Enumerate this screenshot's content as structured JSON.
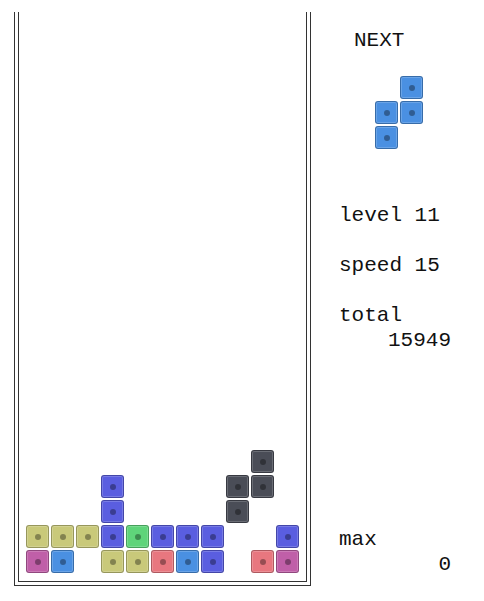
{
  "next": {
    "title": "NEXT",
    "piece": [
      [
        null,
        "#4a90e2"
      ],
      [
        "#4a90e2",
        "#4a90e2"
      ],
      [
        "#4a90e2",
        null
      ]
    ]
  },
  "stats": [
    {
      "label": "level",
      "value": "11",
      "kind": "inline"
    },
    {
      "label": "speed",
      "value": "15",
      "kind": "inline"
    },
    {
      "label": "total",
      "value": "15949",
      "kind": "stacked"
    },
    {
      "label": "max",
      "value": "0",
      "kind": "stacked"
    }
  ],
  "board": {
    "rows": [
      [
        null,
        null,
        null,
        null,
        null,
        null,
        null,
        null,
        null,
        null,
        null
      ],
      [
        null,
        null,
        null,
        null,
        null,
        null,
        null,
        null,
        null,
        null,
        null
      ],
      [
        null,
        null,
        null,
        null,
        null,
        null,
        null,
        null,
        null,
        null,
        null
      ],
      [
        null,
        null,
        null,
        null,
        null,
        null,
        null,
        null,
        null,
        null,
        null
      ],
      [
        null,
        null,
        null,
        null,
        null,
        null,
        null,
        null,
        null,
        null,
        null
      ],
      [
        null,
        null,
        null,
        null,
        null,
        null,
        null,
        null,
        null,
        null,
        null
      ],
      [
        null,
        null,
        null,
        null,
        null,
        null,
        null,
        null,
        null,
        null,
        null
      ],
      [
        null,
        null,
        null,
        null,
        null,
        null,
        null,
        null,
        null,
        null,
        null
      ],
      [
        null,
        null,
        null,
        null,
        null,
        null,
        null,
        null,
        null,
        null,
        null
      ],
      [
        null,
        null,
        null,
        null,
        null,
        null,
        null,
        null,
        null,
        null,
        null
      ],
      [
        null,
        null,
        null,
        null,
        null,
        null,
        null,
        null,
        null,
        null,
        null
      ],
      [
        null,
        null,
        null,
        null,
        null,
        null,
        null,
        null,
        null,
        null,
        null
      ],
      [
        null,
        null,
        null,
        null,
        null,
        null,
        null,
        null,
        null,
        null,
        null
      ],
      [
        null,
        null,
        null,
        null,
        null,
        null,
        null,
        null,
        null,
        null,
        null
      ],
      [
        null,
        null,
        null,
        null,
        null,
        null,
        null,
        null,
        null,
        null,
        null
      ],
      [
        null,
        null,
        null,
        null,
        null,
        null,
        null,
        null,
        null,
        null,
        null
      ],
      [
        null,
        null,
        null,
        null,
        null,
        null,
        null,
        null,
        null,
        null,
        null
      ],
      [
        null,
        null,
        null,
        null,
        null,
        null,
        null,
        null,
        null,
        "#4a4d57",
        null
      ],
      [
        null,
        null,
        null,
        "#5a5ee0",
        null,
        null,
        null,
        null,
        "#4a4d57",
        "#4a4d57",
        null
      ],
      [
        null,
        null,
        null,
        "#5a5ee0",
        null,
        null,
        null,
        null,
        "#4a4d57",
        null,
        null
      ],
      [
        "#c9c97a",
        "#c9c97a",
        "#c9c97a",
        "#5a5ee0",
        "#5fd47a",
        "#5a5ee0",
        "#5a5ee0",
        "#5a5ee0",
        null,
        null,
        "#5a5ee0"
      ],
      [
        "#c05fa8",
        "#4a90e2",
        null,
        "#c9c97a",
        "#c9c97a",
        "#e8777f",
        "#4a90e2",
        "#5a5ee0",
        null,
        "#e8777f",
        "#c05fa8"
      ]
    ]
  }
}
